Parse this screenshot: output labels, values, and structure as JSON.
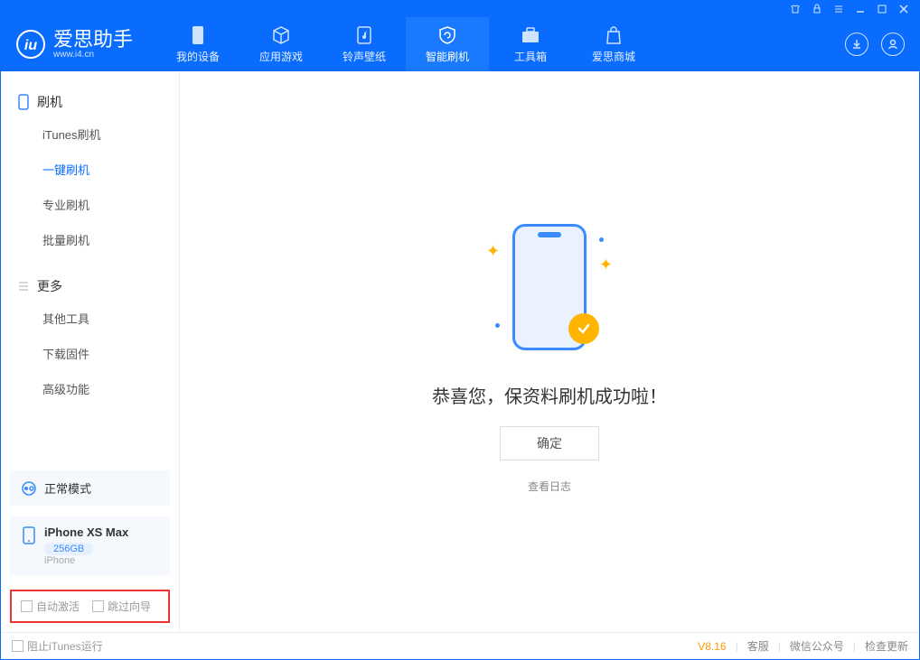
{
  "app": {
    "title": "爱思助手",
    "url": "www.i4.cn"
  },
  "tabs": [
    {
      "label": "我的设备"
    },
    {
      "label": "应用游戏"
    },
    {
      "label": "铃声壁纸"
    },
    {
      "label": "智能刷机"
    },
    {
      "label": "工具箱"
    },
    {
      "label": "爱思商城"
    }
  ],
  "sidebar": {
    "section1": {
      "title": "刷机",
      "items": [
        "iTunes刷机",
        "一键刷机",
        "专业刷机",
        "批量刷机"
      ]
    },
    "section2": {
      "title": "更多",
      "items": [
        "其他工具",
        "下载固件",
        "高级功能"
      ]
    },
    "mode_label": "正常模式",
    "device": {
      "name": "iPhone XS Max",
      "storage": "256GB",
      "type": "iPhone"
    },
    "opt_auto_activate": "自动激活",
    "opt_skip_guide": "跳过向导"
  },
  "main": {
    "success": "恭喜您，保资料刷机成功啦！",
    "ok": "确定",
    "view_log": "查看日志"
  },
  "footer": {
    "block_itunes": "阻止iTunes运行",
    "version": "V8.16",
    "support": "客服",
    "wechat": "微信公众号",
    "update": "检查更新"
  }
}
